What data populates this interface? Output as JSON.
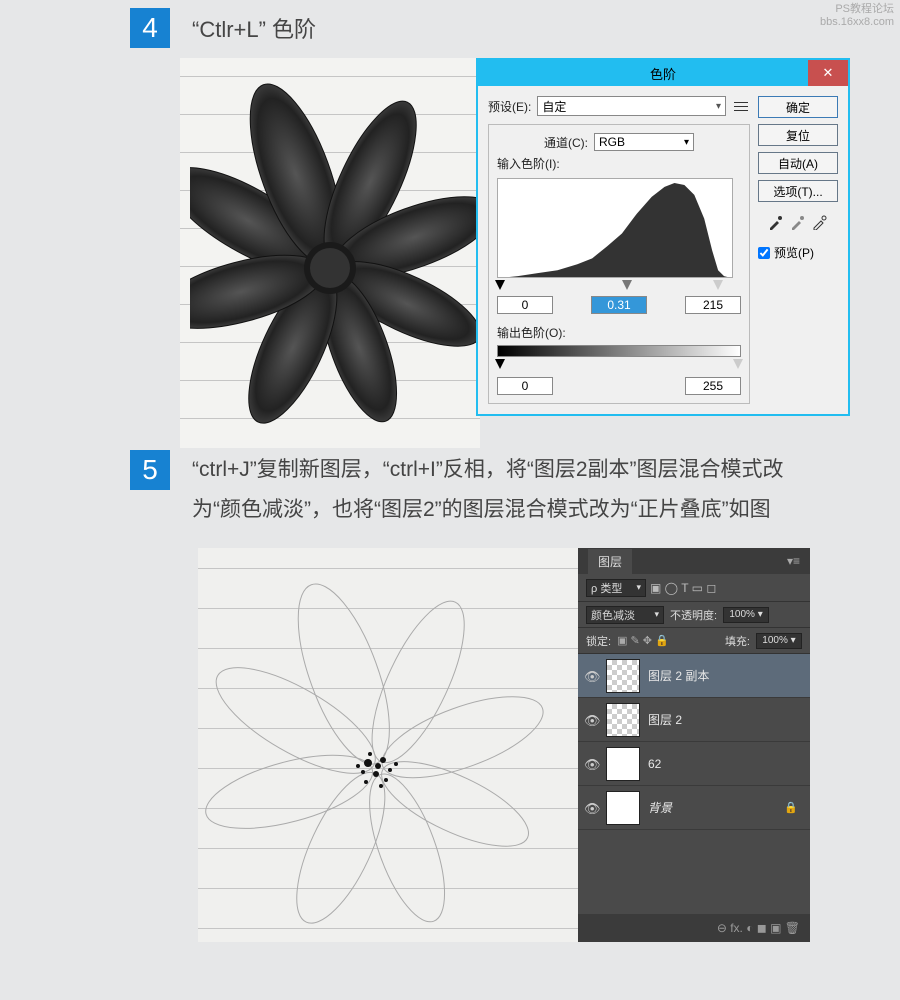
{
  "watermark": {
    "l1": "PS教程论坛",
    "l2": "bbs.16xx8.com"
  },
  "step4": {
    "num": "4",
    "title": "“Ctlr+L” 色阶",
    "dialog": {
      "title": "色阶",
      "preset_lbl": "预设(E):",
      "preset_val": "自定",
      "channel_lbl": "通道(C):",
      "channel_val": "RGB",
      "input_lbl": "输入色阶(I):",
      "in_black": "0",
      "in_gamma": "0.31",
      "in_white": "215",
      "output_lbl": "输出色阶(O):",
      "out_black": "0",
      "out_white": "255",
      "btn_ok": "确定",
      "btn_reset": "复位",
      "btn_auto": "自动(A)",
      "btn_opts": "选项(T)...",
      "preview": "预览(P)"
    }
  },
  "step5": {
    "num": "5",
    "text": "“ctrl+J”复制新图层，“ctrl+I”反相，将“图层2副本”图层混合模式改为“颜色减淡”，也将“图层2”的图层混合模式改为“正片叠底”如图",
    "panel": {
      "tab": "图层",
      "kind": "类型",
      "icons": "▣  ◯  T  ▭  ◻",
      "mode": "颜色减淡",
      "opacity_lbl": "不透明度:",
      "opacity_val": "100%",
      "lock_lbl": "锁定:",
      "lock_icons": "▣  ✎  ✥  🔒",
      "fill_lbl": "填充:",
      "fill_val": "100%",
      "layers": [
        {
          "name": "图层 2 副本",
          "sel": true,
          "checker": true
        },
        {
          "name": "图层 2",
          "checker": true
        },
        {
          "name": "62"
        },
        {
          "name": "背景",
          "italic": true,
          "lock": true
        }
      ],
      "bottom": "⊖   fx.  ◐  ◼  ▣  🗑"
    }
  }
}
